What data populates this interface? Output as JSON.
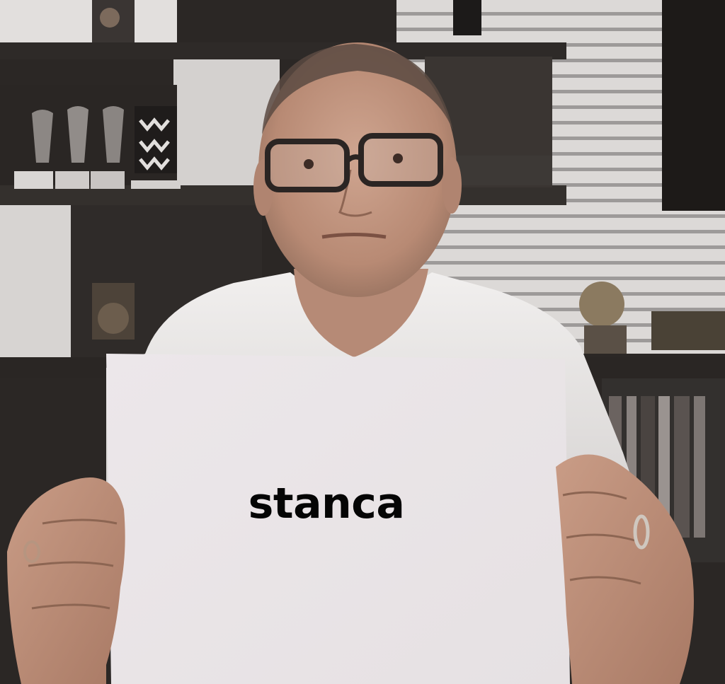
{
  "sign": {
    "text": "stanca"
  },
  "colors": {
    "wall": "#d9d6d4",
    "shelf_dark": "#2d2a28",
    "shirt": "#eeeceb",
    "skin": "#c9a08a",
    "paper": "#ebe6e8",
    "glasses_frame": "#2b2523"
  },
  "icons": {
    "person": "person-holding-sign",
    "glasses": "eyeglasses",
    "trophy": "trophy"
  }
}
